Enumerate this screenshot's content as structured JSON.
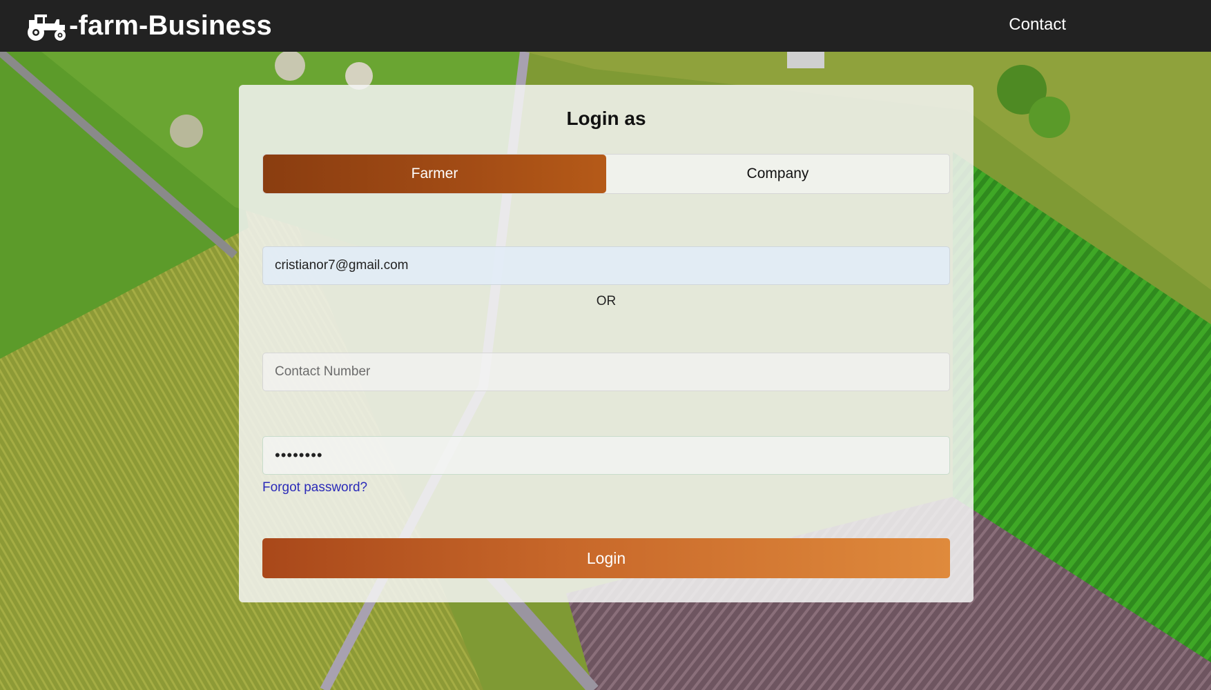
{
  "navbar": {
    "brand_icon": "tractor-icon",
    "brand_text": "-farm-Business",
    "contact_label": "Contact"
  },
  "login": {
    "title": "Login as",
    "roles": [
      {
        "label": "Farmer",
        "active": true
      },
      {
        "label": "Company",
        "active": false
      }
    ],
    "email_value": "cristianor7@gmail.com",
    "or_text": "OR",
    "contact_placeholder": "Contact Number",
    "password_value": "••••••••",
    "forgot_label": "Forgot password?",
    "submit_label": "Login"
  },
  "colors": {
    "navbar_bg": "#222222",
    "active_role": "#9a4512",
    "login_button_start": "#a9481a",
    "login_button_end": "#df8a3c",
    "link": "#2a2ab8"
  }
}
